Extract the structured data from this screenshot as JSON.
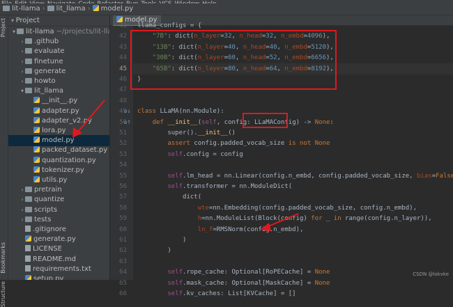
{
  "menubar": {
    "items": [
      "File",
      "Edit",
      "View",
      "Navigate",
      "Code",
      "Refactor",
      "Run",
      "Tools",
      "VCS",
      "Window",
      "Help"
    ]
  },
  "breadcrumbs": [
    "lit-llama",
    "lit_llama",
    "model.py"
  ],
  "sidebar": {
    "labels": [
      "Project",
      "Bookmarks",
      "Structure"
    ]
  },
  "project_panel": {
    "title": "Project",
    "tree": [
      {
        "label": "lit-llama",
        "note": "~/projects/lit-llama",
        "type": "folder",
        "depth": 0,
        "expanded": true
      },
      {
        "label": ".github",
        "type": "folder",
        "depth": 1,
        "expanded": false
      },
      {
        "label": "evaluate",
        "type": "folder",
        "depth": 1,
        "expanded": false
      },
      {
        "label": "finetune",
        "type": "folder",
        "depth": 1,
        "expanded": false
      },
      {
        "label": "generate",
        "type": "folder",
        "depth": 1,
        "expanded": false
      },
      {
        "label": "howto",
        "type": "folder",
        "depth": 1,
        "expanded": false
      },
      {
        "label": "lit_llama",
        "type": "folder",
        "depth": 1,
        "expanded": true
      },
      {
        "label": "__init__.py",
        "type": "py",
        "depth": 2
      },
      {
        "label": "adapter.py",
        "type": "py",
        "depth": 2
      },
      {
        "label": "adapter_v2.py",
        "type": "py",
        "depth": 2
      },
      {
        "label": "lora.py",
        "type": "py",
        "depth": 2
      },
      {
        "label": "model.py",
        "type": "py",
        "depth": 2,
        "selected": true
      },
      {
        "label": "packed_dataset.py",
        "type": "py",
        "depth": 2
      },
      {
        "label": "quantization.py",
        "type": "py",
        "depth": 2
      },
      {
        "label": "tokenizer.py",
        "type": "py",
        "depth": 2
      },
      {
        "label": "utils.py",
        "type": "py",
        "depth": 2
      },
      {
        "label": "pretrain",
        "type": "folder",
        "depth": 1,
        "expanded": false
      },
      {
        "label": "quantize",
        "type": "folder",
        "depth": 1,
        "expanded": false
      },
      {
        "label": "scripts",
        "type": "folder",
        "depth": 1,
        "expanded": false
      },
      {
        "label": "tests",
        "type": "folder",
        "depth": 1,
        "expanded": false
      },
      {
        "label": ".gitignore",
        "type": "file",
        "depth": 1
      },
      {
        "label": "generate.py",
        "type": "py",
        "depth": 1
      },
      {
        "label": "LICENSE",
        "type": "file",
        "depth": 1
      },
      {
        "label": "README.md",
        "type": "file",
        "depth": 1
      },
      {
        "label": "requirements.txt",
        "type": "file",
        "depth": 1
      },
      {
        "label": "setup.py",
        "type": "py",
        "depth": 1
      }
    ]
  },
  "editor": {
    "tab_label": "model.py",
    "current_line": 45,
    "lines": [
      {
        "n": "41",
        "html": "llama_configs = {"
      },
      {
        "n": "42",
        "html": "    <span class='str'>\"7B\"</span>: dict(<span class='param'>n_layer</span>=<span class='num'>32</span>, <span class='param'>n_head</span>=<span class='num'>32</span>, <span class='param'>n_embd</span>=<span class='num'>4096</span>),"
      },
      {
        "n": "43",
        "html": "    <span class='str'>\"13B\"</span>: dict(<span class='param'>n_layer</span>=<span class='num'>40</span>, <span class='param'>n_head</span>=<span class='num'>40</span>, <span class='param'>n_embd</span>=<span class='num'>5120</span>),"
      },
      {
        "n": "44",
        "html": "    <span class='str'>\"30B\"</span>: dict(<span class='param'>n_layer</span>=<span class='num'>60</span>, <span class='param'>n_head</span>=<span class='num'>52</span>, <span class='param'>n_embd</span>=<span class='num'>6656</span>),"
      },
      {
        "n": "45",
        "html": "    <span class='str'>\"65B\"</span>: dict(<span class='param'>n_layer</span>=<span class='num'>80</span>, <span class='param'>n_head</span>=<span class='num'>64</span>, <span class='param'>n_embd</span>=<span class='num'>8192</span>),"
      },
      {
        "n": "46",
        "html": "}"
      },
      {
        "n": "47",
        "html": ""
      },
      {
        "n": "48",
        "html": ""
      },
      {
        "n": "49",
        "html": "<span class='kw'>class</span> LLaMA(nn.Module):"
      },
      {
        "n": "50",
        "html": "    <span class='kw'>def</span> <span class='fn'>__init__</span>(<span class='self'>self</span>, config: LLaMAConfig) -> <span class='kw'>None</span>:"
      },
      {
        "n": "51",
        "html": "        super().<span class='fn'>__init__</span>()"
      },
      {
        "n": "52",
        "html": "        <span class='kw'>assert</span> config.padded_vocab_size <span class='kw'>is not None</span>"
      },
      {
        "n": "53",
        "html": "        <span class='self'>self</span>.config = config"
      },
      {
        "n": "54",
        "html": ""
      },
      {
        "n": "55",
        "html": "        <span class='self'>self</span>.lm_head = nn.Linear(config.n_embd, config.padded_vocab_size, <span class='param'>bias</span>=<span class='kw'>False</span>)"
      },
      {
        "n": "56",
        "html": "        <span class='self'>self</span>.transformer = nn.ModuleDict("
      },
      {
        "n": "57",
        "html": "            dict("
      },
      {
        "n": "58",
        "html": "                <span class='param'>wte</span>=nn.Embedding(config.padded_vocab_size, config.n_embd),"
      },
      {
        "n": "59",
        "html": "                <span class='param'>h</span>=nn.ModuleList(Block(config) <span class='kw'>for</span> _ <span class='kw'>in</span> range(config.n_layer)),"
      },
      {
        "n": "60",
        "html": "                <span class='param'>ln_f</span>=RMSNorm(config.n_embd),"
      },
      {
        "n": "61",
        "html": "            )"
      },
      {
        "n": "62",
        "html": "        )"
      },
      {
        "n": "63",
        "html": ""
      },
      {
        "n": "64",
        "html": "        <span class='self'>self</span>.rope_cache: Optional[RoPECache] = <span class='kw'>None</span>"
      },
      {
        "n": "65",
        "html": "        <span class='self'>self</span>.mask_cache: Optional[MaskCache] = <span class='kw'>None</span>"
      },
      {
        "n": "66",
        "html": "        <span class='self'>self</span>.kv_caches: List[KVCache] = []"
      }
    ]
  },
  "watermark": "CSDN @lokvke",
  "colors": {
    "annotation": "#e0191e",
    "selection": "#0d293e",
    "tab_underline": "#4a88c7"
  }
}
